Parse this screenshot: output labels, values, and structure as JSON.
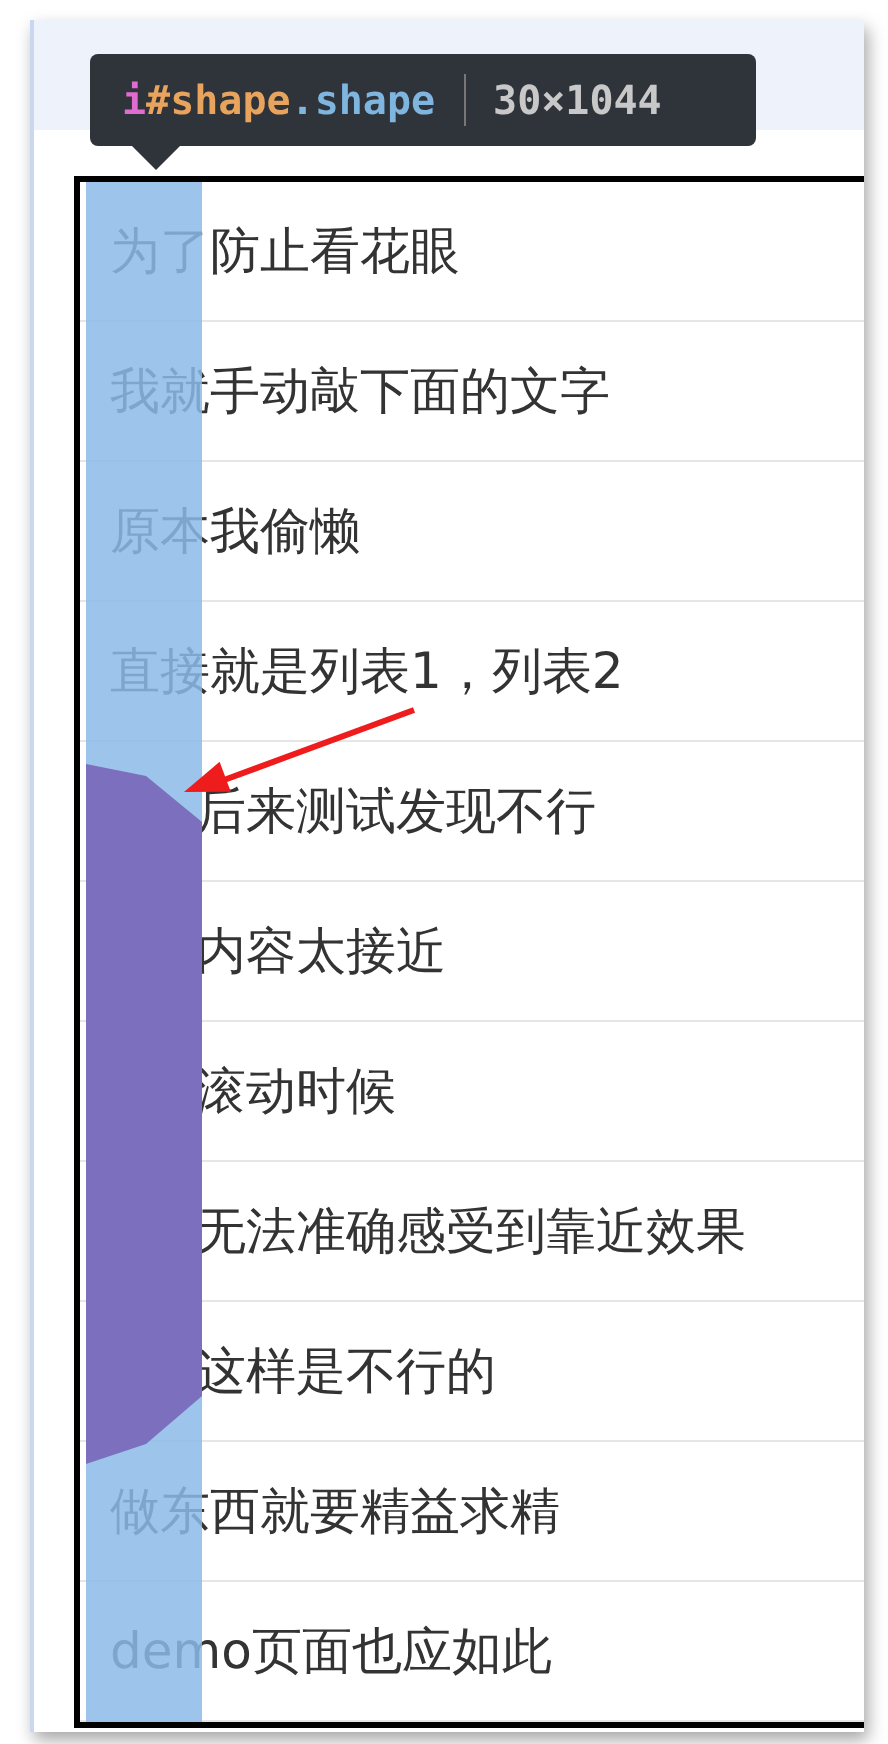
{
  "tooltip": {
    "tag": "i",
    "id": "#shape",
    "class_name": ".shape",
    "size": "30×1044"
  },
  "list": {
    "rows": [
      {
        "text": "为了防止看花眼"
      },
      {
        "text": "我就手动敲下面的文字"
      },
      {
        "text": "原本我偷懒"
      },
      {
        "text": "直接就是列表1，列表2"
      },
      {
        "text": "后来测试发现不行"
      },
      {
        "text": "内容太接近"
      },
      {
        "text": "滚动时候"
      },
      {
        "text": "无法准确感受到靠近效果"
      },
      {
        "text": "这样是不行的"
      },
      {
        "text": "做东西就要精益求精"
      },
      {
        "text": "demo页面也应如此"
      }
    ]
  }
}
